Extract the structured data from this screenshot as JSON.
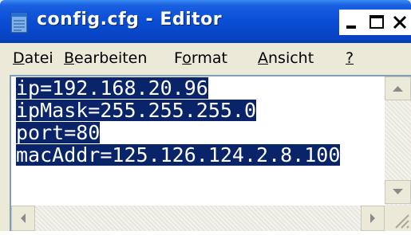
{
  "window": {
    "title": "config.cfg - Editor",
    "icon": "notepad-icon"
  },
  "menu": {
    "items": [
      {
        "accel": "D",
        "rest": "atei"
      },
      {
        "accel": "B",
        "rest": "earbeiten"
      },
      {
        "pre": "F",
        "accel": "o",
        "rest": "rmat"
      },
      {
        "accel": "A",
        "rest": "nsicht"
      },
      {
        "accel": "?",
        "rest": ""
      }
    ]
  },
  "editor": {
    "lines": [
      "ip=192.168.20.96",
      "ipMask=255.255.255.0",
      "port=80",
      "macAddr=125.126.124.2.8.100"
    ],
    "selection_color": "#0a246a",
    "selected_text_color": "#ffffff"
  },
  "colors": {
    "titlebar": "#0a4fd6",
    "chrome": "#ece9d8"
  }
}
